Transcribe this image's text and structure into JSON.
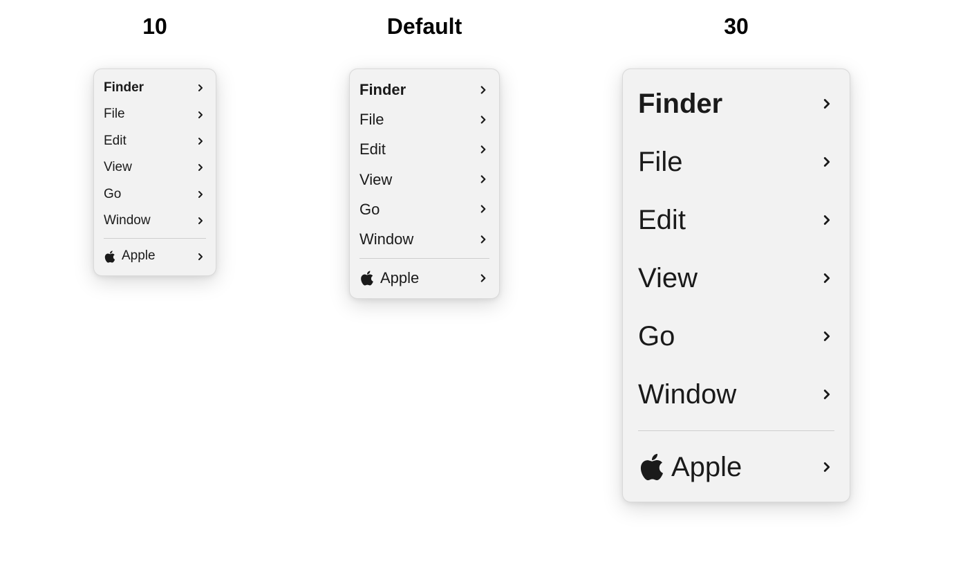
{
  "variants": [
    {
      "title": "10",
      "sizeClass": "size-10",
      "iconSize": 18,
      "chevSize": 16
    },
    {
      "title": "Default",
      "sizeClass": "size-default",
      "iconSize": 22,
      "chevSize": 18
    },
    {
      "title": "30",
      "sizeClass": "size-30",
      "iconSize": 40,
      "chevSize": 22
    }
  ],
  "menu": {
    "items": [
      {
        "label": "Finder",
        "bold": true
      },
      {
        "label": "File"
      },
      {
        "label": "Edit"
      },
      {
        "label": "View"
      },
      {
        "label": "Go"
      },
      {
        "label": "Window"
      }
    ],
    "appleItem": {
      "label": "Apple"
    }
  }
}
